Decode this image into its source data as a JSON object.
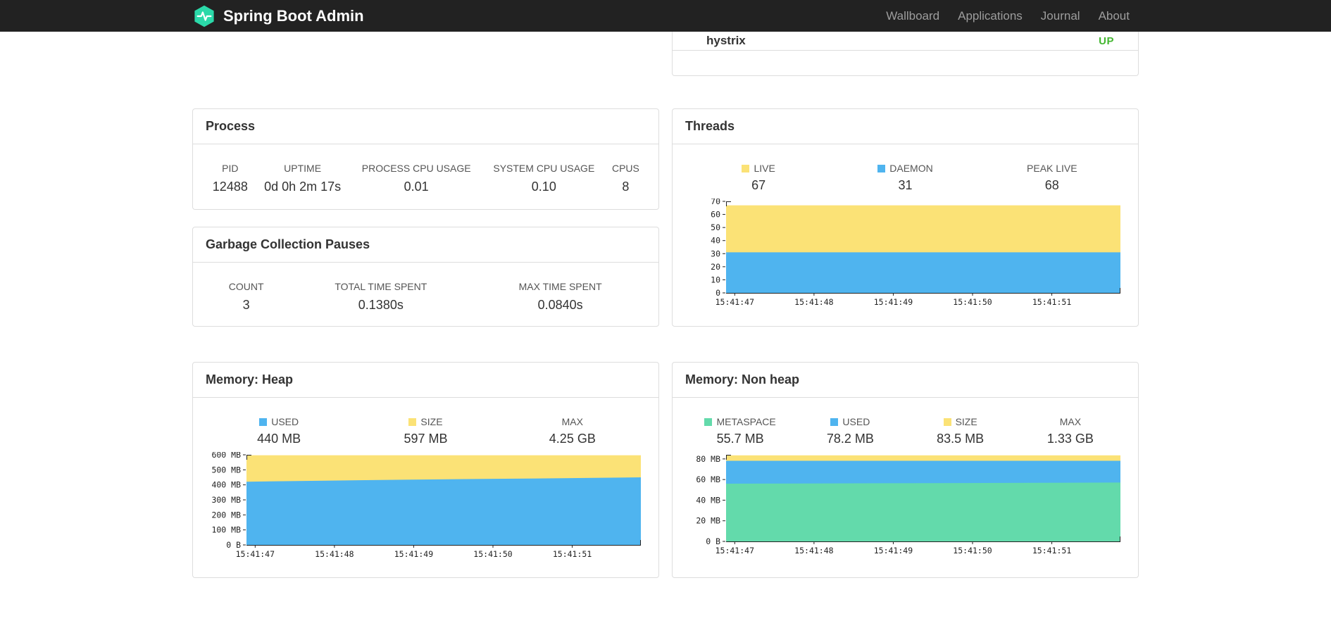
{
  "navbar": {
    "brand": "Spring Boot Admin",
    "items": [
      {
        "label": "Wallboard"
      },
      {
        "label": "Applications"
      },
      {
        "label": "Journal"
      },
      {
        "label": "About"
      }
    ]
  },
  "health": {
    "rows": [
      {
        "name": "hystrix",
        "status": "UP"
      }
    ]
  },
  "panels": {
    "process": {
      "title": "Process",
      "metrics": [
        {
          "label": "PID",
          "value": "12488"
        },
        {
          "label": "UPTIME",
          "value": "0d 0h 2m 17s"
        },
        {
          "label": "PROCESS CPU USAGE",
          "value": "0.01"
        },
        {
          "label": "SYSTEM CPU USAGE",
          "value": "0.10"
        },
        {
          "label": "CPUS",
          "value": "8"
        }
      ]
    },
    "gc": {
      "title": "Garbage Collection Pauses",
      "metrics": [
        {
          "label": "COUNT",
          "value": "3"
        },
        {
          "label": "TOTAL TIME SPENT",
          "value": "0.1380s"
        },
        {
          "label": "MAX TIME SPENT",
          "value": "0.0840s"
        }
      ]
    },
    "threads": {
      "title": "Threads",
      "legend": [
        {
          "swatch": "yellow",
          "label": "LIVE",
          "value": "67"
        },
        {
          "swatch": "blue",
          "label": "DAEMON",
          "value": "31"
        },
        {
          "swatch": null,
          "label": "PEAK LIVE",
          "value": "68"
        }
      ]
    },
    "heap": {
      "title": "Memory: Heap",
      "legend": [
        {
          "swatch": "blue",
          "label": "USED",
          "value": "440 MB"
        },
        {
          "swatch": "yellow",
          "label": "SIZE",
          "value": "597 MB"
        },
        {
          "swatch": null,
          "label": "MAX",
          "value": "4.25 GB"
        }
      ]
    },
    "nonheap": {
      "title": "Memory: Non heap",
      "legend": [
        {
          "swatch": "green",
          "label": "METASPACE",
          "value": "55.7 MB"
        },
        {
          "swatch": "blue",
          "label": "USED",
          "value": "78.2 MB"
        },
        {
          "swatch": "yellow",
          "label": "SIZE",
          "value": "83.5 MB"
        },
        {
          "swatch": null,
          "label": "MAX",
          "value": "1.33 GB"
        }
      ]
    }
  },
  "colors": {
    "yellow": "#FBE276",
    "blue": "#4FB4EF",
    "green": "#63DAAB",
    "status_up": "#42B62F",
    "navbar_bg": "#222222",
    "logo_teal": "#2BD9A9"
  },
  "chart_data": [
    {
      "type": "area",
      "title": "Threads",
      "stacking": "absolute-tops",
      "x_labels": [
        "15:41:47",
        "15:41:48",
        "15:41:49",
        "15:41:50",
        "15:41:51"
      ],
      "x_points": [
        0,
        0.2,
        0.4,
        0.6,
        0.8,
        1
      ],
      "x_tick_fractions": [
        0.022,
        0.223,
        0.424,
        0.625,
        0.826
      ],
      "ylim": [
        0,
        70
      ],
      "yticks": [
        {
          "value": 70,
          "label": "70"
        },
        {
          "value": 60,
          "label": "60"
        },
        {
          "value": 50,
          "label": "50"
        },
        {
          "value": 40,
          "label": "40"
        },
        {
          "value": 30,
          "label": "30"
        },
        {
          "value": 20,
          "label": "20"
        },
        {
          "value": 10,
          "label": "10"
        },
        {
          "value": 0,
          "label": "0"
        }
      ],
      "series": [
        {
          "name": "LIVE",
          "color": "yellow",
          "values": [
            67,
            67,
            67,
            67,
            67,
            67
          ]
        },
        {
          "name": "DAEMON",
          "color": "blue",
          "values": [
            31,
            31,
            31,
            31,
            31,
            31
          ]
        }
      ]
    },
    {
      "type": "area",
      "title": "Memory: Heap",
      "stacking": "absolute-tops",
      "x_labels": [
        "15:41:47",
        "15:41:48",
        "15:41:49",
        "15:41:50",
        "15:41:51"
      ],
      "x_points": [
        0,
        0.2,
        0.4,
        0.6,
        0.8,
        1
      ],
      "x_tick_fractions": [
        0.022,
        0.223,
        0.424,
        0.625,
        0.826
      ],
      "ylim": [
        0,
        600
      ],
      "yticks": [
        {
          "value": 600,
          "label": "600 MB"
        },
        {
          "value": 500,
          "label": "500 MB"
        },
        {
          "value": 400,
          "label": "400 MB"
        },
        {
          "value": 300,
          "label": "300 MB"
        },
        {
          "value": 200,
          "label": "200 MB"
        },
        {
          "value": 100,
          "label": "100 MB"
        },
        {
          "value": 0,
          "label": "0 B"
        }
      ],
      "series": [
        {
          "name": "SIZE",
          "color": "yellow",
          "values": [
            597,
            597,
            597,
            597,
            597,
            597
          ]
        },
        {
          "name": "USED",
          "color": "blue",
          "values": [
            421,
            428,
            434,
            439,
            444,
            450
          ]
        }
      ]
    },
    {
      "type": "area",
      "title": "Memory: Non heap",
      "stacking": "absolute-tops",
      "x_labels": [
        "15:41:47",
        "15:41:48",
        "15:41:49",
        "15:41:50",
        "15:41:51"
      ],
      "x_points": [
        0,
        0.2,
        0.4,
        0.6,
        0.8,
        1
      ],
      "x_tick_fractions": [
        0.022,
        0.223,
        0.424,
        0.625,
        0.826
      ],
      "ylim": [
        0,
        84
      ],
      "yticks": [
        {
          "value": 80,
          "label": "80 MB"
        },
        {
          "value": 60,
          "label": "60 MB"
        },
        {
          "value": 40,
          "label": "40 MB"
        },
        {
          "value": 20,
          "label": "20 MB"
        },
        {
          "value": 0,
          "label": "0 B"
        }
      ],
      "series": [
        {
          "name": "SIZE",
          "color": "yellow",
          "values": [
            83.5,
            83.5,
            83.5,
            83.5,
            83.5,
            83.5
          ]
        },
        {
          "name": "USED",
          "color": "blue",
          "values": [
            78.2,
            78.2,
            78.2,
            78.2,
            78.2,
            78.2
          ]
        },
        {
          "name": "METASPACE",
          "color": "green",
          "values": [
            56,
            56.2,
            56.4,
            56.6,
            56.9,
            57.1
          ]
        }
      ]
    }
  ]
}
